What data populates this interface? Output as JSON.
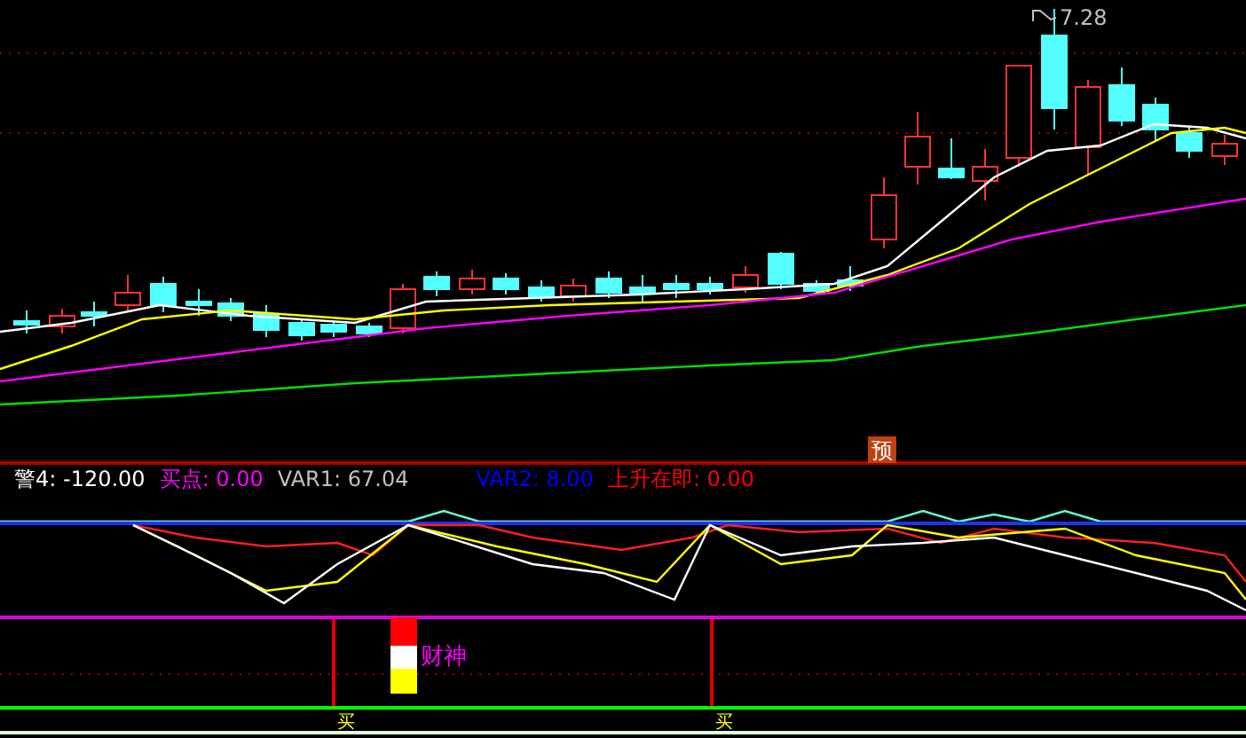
{
  "price_chart": {
    "high_label": "7.28",
    "signal_mark": "预"
  },
  "indicator_legend": [
    {
      "text": "警4: -120.00",
      "color": "#ffffff"
    },
    {
      "text": "买点: 0.00",
      "color": "#ff00ff"
    },
    {
      "text": "VAR1: 67.04",
      "color": "#c0c0c0"
    },
    {
      "text": "VAR2: 8.00",
      "color": "#0000ff"
    },
    {
      "text": "上升在即: 0.00",
      "color": "#ff0000"
    }
  ],
  "signal_panel": {
    "buy_marks": [
      "买",
      "买"
    ],
    "label": "财神"
  }
}
